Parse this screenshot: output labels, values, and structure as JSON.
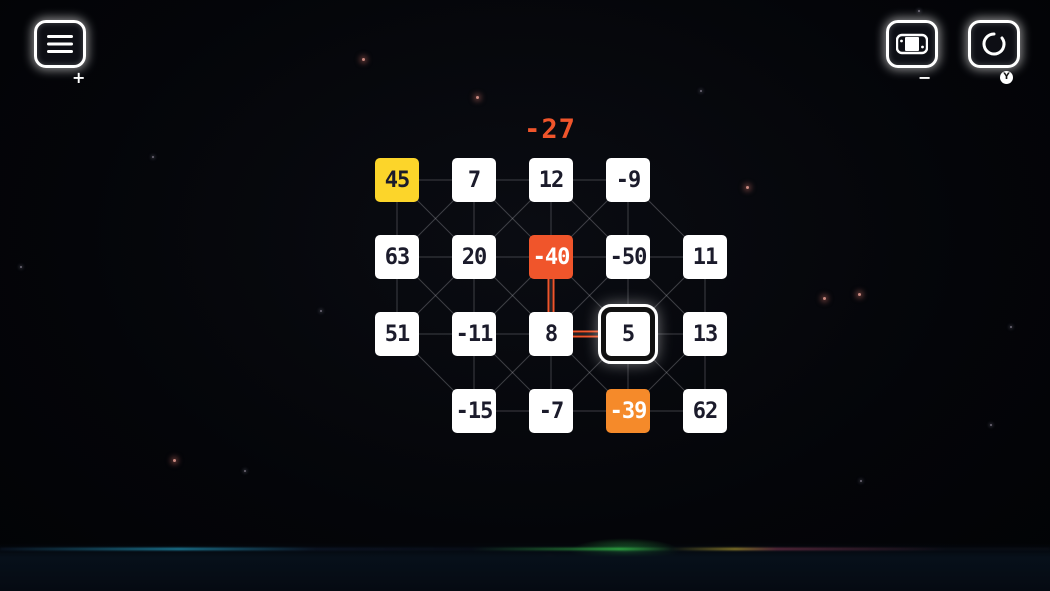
{
  "target_value": "-27",
  "controls": {
    "menu_button": {
      "icon": "menu-icon",
      "hint": "+"
    },
    "controller_button": {
      "icon": "controller-icon",
      "hint": "−"
    },
    "restart_button": {
      "icon": "restart-icon",
      "hint": "Y"
    }
  },
  "grid": {
    "columns": 5,
    "rows": 4,
    "tiles": [
      {
        "row": 0,
        "col": 0,
        "value": "45",
        "state": "yellow"
      },
      {
        "row": 0,
        "col": 1,
        "value": "7",
        "state": "normal"
      },
      {
        "row": 0,
        "col": 2,
        "value": "12",
        "state": "normal"
      },
      {
        "row": 0,
        "col": 3,
        "value": "-9",
        "state": "normal"
      },
      {
        "row": 1,
        "col": 0,
        "value": "63",
        "state": "normal"
      },
      {
        "row": 1,
        "col": 1,
        "value": "20",
        "state": "normal"
      },
      {
        "row": 1,
        "col": 2,
        "value": "-40",
        "state": "red"
      },
      {
        "row": 1,
        "col": 3,
        "value": "-50",
        "state": "normal"
      },
      {
        "row": 1,
        "col": 4,
        "value": "11",
        "state": "normal"
      },
      {
        "row": 2,
        "col": 0,
        "value": "51",
        "state": "normal"
      },
      {
        "row": 2,
        "col": 1,
        "value": "-11",
        "state": "normal"
      },
      {
        "row": 2,
        "col": 2,
        "value": "8",
        "state": "normal"
      },
      {
        "row": 2,
        "col": 3,
        "value": "5",
        "state": "selected"
      },
      {
        "row": 2,
        "col": 4,
        "value": "13",
        "state": "normal"
      },
      {
        "row": 3,
        "col": 1,
        "value": "-15",
        "state": "normal"
      },
      {
        "row": 3,
        "col": 2,
        "value": "-7",
        "state": "normal"
      },
      {
        "row": 3,
        "col": 3,
        "value": "-39",
        "state": "orange"
      },
      {
        "row": 3,
        "col": 4,
        "value": "62",
        "state": "normal"
      }
    ],
    "path": [
      [
        1,
        2
      ],
      [
        2,
        2
      ],
      [
        2,
        3
      ]
    ]
  },
  "colors": {
    "target": "#f0552b",
    "path": "#f0552b",
    "tile_yellow": "#fcd52a",
    "tile_red": "#f0552b",
    "tile_orange": "#f58a2a",
    "tile_normal": "#ffffff",
    "tile_text": "#1b1b2b"
  }
}
